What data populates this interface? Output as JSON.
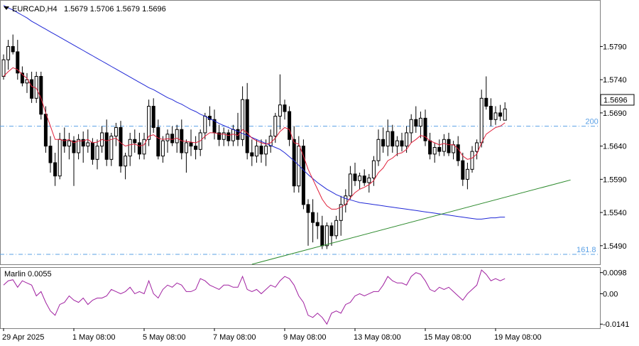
{
  "header": {
    "symbol_label": "EURCAD,H4",
    "ohlc": "1.5679 1.5706 1.5679 1.5696"
  },
  "indicator": {
    "label": "Marlin 0.0055"
  },
  "price_badge": "1.5696",
  "fib_levels": [
    {
      "label": "200",
      "price": 1.567
    },
    {
      "label": "161.8",
      "price": 1.5477
    }
  ],
  "colors": {
    "background": "#ffffff",
    "grid": "#c8c8c8",
    "bull_body": "#ffffff",
    "bear_body": "#000000",
    "candle_line": "#000000",
    "ma_fast": "#e0203a",
    "ma_slow": "#1f27d6",
    "trendline": "#2e8b2e",
    "fib": "#5aa0e6",
    "oscillator": "#a020a0"
  },
  "chart_data": [
    {
      "type": "candlestick",
      "title": "EURCAD,H4",
      "y_ticks": [
        "1.5790",
        "1.5740",
        "1.5690",
        "1.5640",
        "1.5590",
        "1.5540",
        "1.5490"
      ],
      "ylim": [
        1.5462,
        1.586
      ],
      "x_ticks": [
        {
          "label": "29 Apr 2025",
          "bar": 0
        },
        {
          "label": "1 May 08:00",
          "bar": 15
        },
        {
          "label": "5 May 08:00",
          "bar": 30
        },
        {
          "label": "7 May 08:00",
          "bar": 45
        },
        {
          "label": "9 May 08:00",
          "bar": 60
        },
        {
          "label": "13 May 08:00",
          "bar": 75
        },
        {
          "label": "15 May 08:00",
          "bar": 90
        },
        {
          "label": "19 May 08:00",
          "bar": 105
        }
      ],
      "candles": [
        [
          1.5745,
          1.5778,
          1.574,
          1.577
        ],
        [
          1.577,
          1.58,
          1.5755,
          1.579
        ],
        [
          1.579,
          1.5808,
          1.5778,
          1.5782
        ],
        [
          1.5782,
          1.58,
          1.574,
          1.575
        ],
        [
          1.575,
          1.576,
          1.573,
          1.5735
        ],
        [
          1.5735,
          1.575,
          1.572,
          1.574
        ],
        [
          1.574,
          1.5752,
          1.5705,
          1.5712
        ],
        [
          1.5712,
          1.5752,
          1.5705,
          1.5745
        ],
        [
          1.5745,
          1.5752,
          1.568,
          1.5688
        ],
        [
          1.5688,
          1.57,
          1.563,
          1.564
        ],
        [
          1.564,
          1.5655,
          1.56,
          1.5615
        ],
        [
          1.5615,
          1.563,
          1.558,
          1.5595
        ],
        [
          1.5595,
          1.566,
          1.559,
          1.565
        ],
        [
          1.565,
          1.5668,
          1.563,
          1.564
        ],
        [
          1.564,
          1.566,
          1.562,
          1.5648
        ],
        [
          1.5648,
          1.5655,
          1.558,
          1.563
        ],
        [
          1.563,
          1.5658,
          1.562,
          1.565
        ],
        [
          1.565,
          1.5662,
          1.5615,
          1.564
        ],
        [
          1.564,
          1.5665,
          1.563,
          1.5645
        ],
        [
          1.5645,
          1.5652,
          1.5612,
          1.562
        ],
        [
          1.562,
          1.565,
          1.5605,
          1.564
        ],
        [
          1.564,
          1.567,
          1.563,
          1.566
        ],
        [
          1.566,
          1.568,
          1.561,
          1.562
        ],
        [
          1.562,
          1.566,
          1.561,
          1.5655
        ],
        [
          1.5655,
          1.5675,
          1.564,
          1.5668
        ],
        [
          1.5668,
          1.5678,
          1.56,
          1.561
        ],
        [
          1.561,
          1.563,
          1.559,
          1.5625
        ],
        [
          1.5625,
          1.566,
          1.561,
          1.565
        ],
        [
          1.565,
          1.5665,
          1.563,
          1.5645
        ],
        [
          1.5645,
          1.566,
          1.562,
          1.5628
        ],
        [
          1.5628,
          1.566,
          1.562,
          1.565
        ],
        [
          1.565,
          1.571,
          1.564,
          1.57
        ],
        [
          1.57,
          1.5712,
          1.566,
          1.5668
        ],
        [
          1.5668,
          1.568,
          1.562,
          1.5625
        ],
        [
          1.5625,
          1.5655,
          1.5615,
          1.5648
        ],
        [
          1.5648,
          1.5665,
          1.563,
          1.5658
        ],
        [
          1.5658,
          1.567,
          1.564,
          1.5645
        ],
        [
          1.5645,
          1.5672,
          1.563,
          1.5665
        ],
        [
          1.5665,
          1.568,
          1.562,
          1.563
        ],
        [
          1.563,
          1.565,
          1.56,
          1.5645
        ],
        [
          1.5645,
          1.5665,
          1.5625,
          1.564
        ],
        [
          1.564,
          1.5655,
          1.562,
          1.5635
        ],
        [
          1.5635,
          1.5665,
          1.5625,
          1.566
        ],
        [
          1.566,
          1.569,
          1.565,
          1.5685
        ],
        [
          1.5685,
          1.57,
          1.567,
          1.568
        ],
        [
          1.568,
          1.5695,
          1.565,
          1.566
        ],
        [
          1.566,
          1.5672,
          1.564,
          1.565
        ],
        [
          1.565,
          1.5668,
          1.564,
          1.566
        ],
        [
          1.566,
          1.5665,
          1.564,
          1.5648
        ],
        [
          1.5648,
          1.5672,
          1.564,
          1.5665
        ],
        [
          1.5665,
          1.569,
          1.564,
          1.565
        ],
        [
          1.565,
          1.573,
          1.564,
          1.571
        ],
        [
          1.571,
          1.5735,
          1.562,
          1.563
        ],
        [
          1.563,
          1.565,
          1.561,
          1.5625
        ],
        [
          1.5625,
          1.565,
          1.5615,
          1.564
        ],
        [
          1.564,
          1.565,
          1.5615,
          1.5628
        ],
        [
          1.5628,
          1.565,
          1.561,
          1.564
        ],
        [
          1.564,
          1.5665,
          1.563,
          1.5655
        ],
        [
          1.5655,
          1.569,
          1.5645,
          1.5685
        ],
        [
          1.5685,
          1.5748,
          1.5665,
          1.5702
        ],
        [
          1.5702,
          1.571,
          1.568,
          1.5692
        ],
        [
          1.5692,
          1.57,
          1.564,
          1.565
        ],
        [
          1.565,
          1.567,
          1.557,
          1.558
        ],
        [
          1.558,
          1.5655,
          1.557,
          1.564
        ],
        [
          1.564,
          1.565,
          1.5545,
          1.5552
        ],
        [
          1.5552,
          1.556,
          1.549,
          1.554
        ],
        [
          1.554,
          1.556,
          1.5495,
          1.5525
        ],
        [
          1.5525,
          1.554,
          1.55,
          1.552
        ],
        [
          1.552,
          1.5535,
          1.5485,
          1.549
        ],
        [
          1.549,
          1.5525,
          1.5485,
          1.552
        ],
        [
          1.552,
          1.5525,
          1.549,
          1.5505
        ],
        [
          1.5505,
          1.5535,
          1.55,
          1.5528
        ],
        [
          1.5528,
          1.5565,
          1.5505,
          1.5552
        ],
        [
          1.5552,
          1.5575,
          1.554,
          1.5565
        ],
        [
          1.5565,
          1.561,
          1.556,
          1.5598
        ],
        [
          1.5598,
          1.5615,
          1.558,
          1.5588
        ],
        [
          1.5588,
          1.56,
          1.5575,
          1.5595
        ],
        [
          1.5595,
          1.5605,
          1.558,
          1.5585
        ],
        [
          1.5585,
          1.5598,
          1.557,
          1.5592
        ],
        [
          1.5592,
          1.5625,
          1.558,
          1.5618
        ],
        [
          1.5618,
          1.5665,
          1.561,
          1.565
        ],
        [
          1.565,
          1.5668,
          1.563,
          1.564
        ],
        [
          1.564,
          1.568,
          1.5625,
          1.5662
        ],
        [
          1.5662,
          1.5672,
          1.563,
          1.564
        ],
        [
          1.564,
          1.5655,
          1.5625,
          1.5648
        ],
        [
          1.5648,
          1.566,
          1.5632,
          1.564
        ],
        [
          1.564,
          1.567,
          1.563,
          1.566
        ],
        [
          1.566,
          1.5688,
          1.5645,
          1.568
        ],
        [
          1.568,
          1.57,
          1.566,
          1.567
        ],
        [
          1.567,
          1.5692,
          1.5652,
          1.5682
        ],
        [
          1.5682,
          1.5695,
          1.564,
          1.5648
        ],
        [
          1.5648,
          1.566,
          1.562,
          1.5628
        ],
        [
          1.5628,
          1.5645,
          1.5615,
          1.5638
        ],
        [
          1.5638,
          1.565,
          1.5625,
          1.5632
        ],
        [
          1.5632,
          1.5658,
          1.5625,
          1.565
        ],
        [
          1.565,
          1.566,
          1.5625,
          1.563
        ],
        [
          1.563,
          1.5648,
          1.562,
          1.5642
        ],
        [
          1.5642,
          1.5655,
          1.561,
          1.5618
        ],
        [
          1.5618,
          1.563,
          1.558,
          1.559
        ],
        [
          1.559,
          1.5615,
          1.5575,
          1.5605
        ],
        [
          1.5605,
          1.564,
          1.56,
          1.5632
        ],
        [
          1.5632,
          1.565,
          1.562,
          1.5645
        ],
        [
          1.5645,
          1.5725,
          1.5638,
          1.5712
        ],
        [
          1.5712,
          1.5745,
          1.5695,
          1.57
        ],
        [
          1.57,
          1.5712,
          1.567,
          1.568
        ],
        [
          1.568,
          1.57,
          1.5672,
          1.569
        ],
        [
          1.569,
          1.5702,
          1.5678,
          1.5685
        ],
        [
          1.5679,
          1.5706,
          1.5679,
          1.5696
        ]
      ],
      "ma_fast": [
        1.5745,
        1.5752,
        1.5758,
        1.5755,
        1.5748,
        1.5742,
        1.573,
        1.5727,
        1.5712,
        1.569,
        1.567,
        1.565,
        1.565,
        1.5648,
        1.565,
        1.5645,
        1.5648,
        1.5648,
        1.565,
        1.5645,
        1.5646,
        1.565,
        1.5648,
        1.565,
        1.5652,
        1.5645,
        1.564,
        1.5642,
        1.5643,
        1.564,
        1.5642,
        1.5655,
        1.5657,
        1.5652,
        1.565,
        1.5651,
        1.565,
        1.5652,
        1.5648,
        1.5647,
        1.5646,
        1.5645,
        1.5648,
        1.5655,
        1.566,
        1.566,
        1.5658,
        1.5658,
        1.5656,
        1.5658,
        1.5656,
        1.5665,
        1.566,
        1.5652,
        1.5648,
        1.5645,
        1.5643,
        1.5645,
        1.5652,
        1.5662,
        1.5668,
        1.5665,
        1.5645,
        1.5643,
        1.5625,
        1.5605,
        1.559,
        1.5575,
        1.556,
        1.555,
        1.5545,
        1.5545,
        1.5548,
        1.5552,
        1.5562,
        1.557,
        1.5575,
        1.5578,
        1.5582,
        1.5588,
        1.56,
        1.5607,
        1.5618,
        1.5622,
        1.5628,
        1.563,
        1.5635,
        1.5645,
        1.565,
        1.5656,
        1.5654,
        1.5648,
        1.5645,
        1.5642,
        1.5644,
        1.5642,
        1.5642,
        1.5636,
        1.5625,
        1.562,
        1.5622,
        1.5628,
        1.5645,
        1.5658,
        1.5663,
        1.5668,
        1.567,
        1.5675
      ],
      "ma_slow": [
        1.5852,
        1.5848,
        1.5845,
        1.5841,
        1.5837,
        1.5833,
        1.5828,
        1.5824,
        1.582,
        1.5816,
        1.5812,
        1.5808,
        1.5804,
        1.58,
        1.5796,
        1.5792,
        1.5788,
        1.5784,
        1.578,
        1.5776,
        1.5772,
        1.5768,
        1.5764,
        1.576,
        1.5756,
        1.5752,
        1.5748,
        1.5744,
        1.574,
        1.5736,
        1.5732,
        1.5728,
        1.5725,
        1.5721,
        1.5717,
        1.5713,
        1.571,
        1.5706,
        1.5703,
        1.5699,
        1.5695,
        1.5692,
        1.5688,
        1.5685,
        1.5681,
        1.5678,
        1.5674,
        1.5671,
        1.5668,
        1.5665,
        1.5662,
        1.5659,
        1.5656,
        1.5653,
        1.565,
        1.5647,
        1.5644,
        1.5641,
        1.5638,
        1.5635,
        1.563,
        1.5624,
        1.5618,
        1.5611,
        1.5604,
        1.5597,
        1.5591,
        1.5585,
        1.558,
        1.5575,
        1.5571,
        1.5567,
        1.5564,
        1.5561,
        1.5559,
        1.5557,
        1.5555,
        1.5554,
        1.5553,
        1.5552,
        1.5551,
        1.555,
        1.5549,
        1.5548,
        1.5547,
        1.5546,
        1.5545,
        1.5544,
        1.5543,
        1.5542,
        1.5541,
        1.554,
        1.5539,
        1.5538,
        1.5537,
        1.5536,
        1.5535,
        1.5534,
        1.5533,
        1.5532,
        1.5531,
        1.553,
        1.553,
        1.5531,
        1.5532,
        1.5532,
        1.5533,
        1.5533
      ],
      "trendline": {
        "from": {
          "bar": 53,
          "price": 1.5462
        },
        "to": {
          "bar": 121,
          "price": 1.5589
        }
      }
    },
    {
      "type": "line",
      "title": "Marlin 0.0055",
      "y_ticks": [
        "0.0098",
        "0.00",
        "-0.0141"
      ],
      "ylim": [
        -0.016,
        0.012
      ],
      "values": [
        0.004,
        0.006,
        0.0065,
        0.003,
        0.006,
        0.005,
        0.004,
        -0.001,
        0.001,
        -0.004,
        -0.008,
        -0.01,
        -0.005,
        -0.004,
        -0.001,
        -0.003,
        -0.004,
        -0.002,
        -0.005,
        -0.003,
        -0.002,
        -0.002,
        -0.001,
        0.002,
        0.001,
        0.0,
        0.001,
        0.003,
        0.0,
        0.001,
        0.0,
        0.006,
        0.0,
        -0.002,
        0.002,
        0.004,
        0.003,
        0.005,
        0.004,
        0.001,
        0.001,
        0.002,
        0.007,
        0.006,
        0.004,
        0.003,
        0.002,
        0.004,
        0.004,
        0.003,
        0.003,
        0.008,
        0.002,
        0.001,
        0.002,
        0.0,
        0.002,
        0.004,
        0.003,
        0.006,
        0.008,
        0.007,
        0.004,
        -0.001,
        -0.004,
        -0.01,
        -0.011,
        -0.009,
        -0.011,
        -0.0141,
        -0.009,
        -0.008,
        -0.009,
        -0.005,
        -0.004,
        -0.001,
        0.0,
        -0.001,
        0.0,
        0.001,
        0.001,
        0.004,
        0.008,
        0.006,
        0.005,
        0.005,
        0.004,
        0.008,
        0.0098,
        0.009,
        0.006,
        0.002,
        0.001,
        0.003,
        0.002,
        0.003,
        0.001,
        -0.001,
        -0.003,
        0.0,
        0.002,
        0.004,
        0.011,
        0.009,
        0.006,
        0.007,
        0.006,
        0.007
      ]
    }
  ]
}
